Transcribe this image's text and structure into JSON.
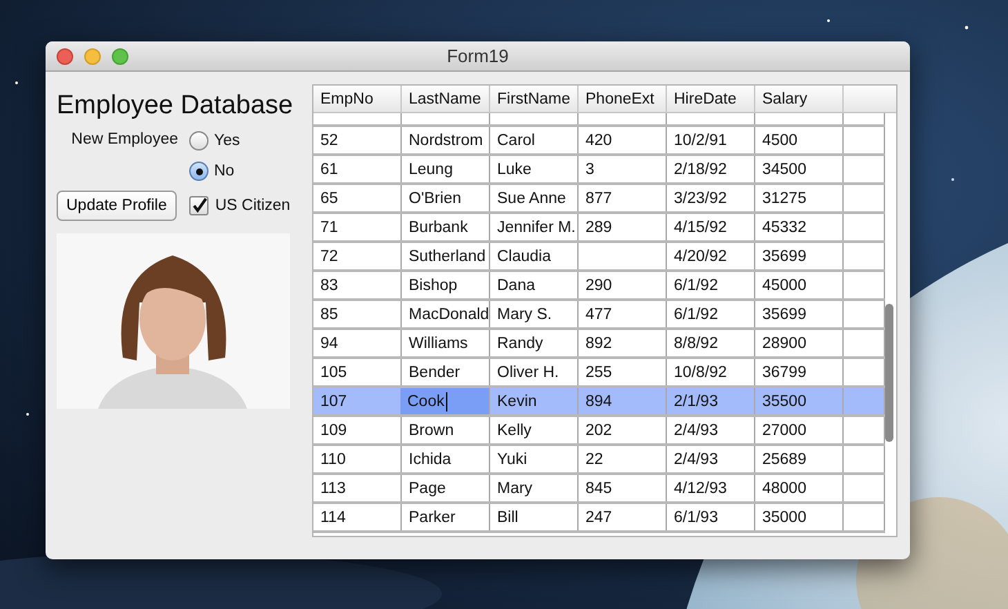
{
  "window": {
    "title": "Form19"
  },
  "form": {
    "heading": "Employee Database",
    "new_employee": {
      "label": "New Employee",
      "options": [
        {
          "label": "Yes",
          "selected": false
        },
        {
          "label": "No",
          "selected": true
        }
      ]
    },
    "update_button": "Update Profile",
    "us_citizen": {
      "label": "US Citizen",
      "checked": true
    }
  },
  "table": {
    "columns": [
      "EmpNo",
      "LastName",
      "FirstName",
      "PhoneExt",
      "HireDate",
      "Salary"
    ],
    "rows": [
      {
        "cells": [
          "52",
          "Nordstrom",
          "Carol",
          "420",
          "10/2/91",
          "4500"
        ],
        "selected": false,
        "editing": false
      },
      {
        "cells": [
          "61",
          "Leung",
          "Luke",
          "3",
          "2/18/92",
          "34500"
        ],
        "selected": false,
        "editing": false
      },
      {
        "cells": [
          "65",
          "O'Brien",
          "Sue Anne",
          "877",
          "3/23/92",
          "31275"
        ],
        "selected": false,
        "editing": false
      },
      {
        "cells": [
          "71",
          "Burbank",
          "Jennifer M.",
          "289",
          "4/15/92",
          "45332"
        ],
        "selected": false,
        "editing": false
      },
      {
        "cells": [
          "72",
          "Sutherland",
          "Claudia",
          null,
          "4/20/92",
          "35699"
        ],
        "selected": false,
        "editing": false
      },
      {
        "cells": [
          "83",
          "Bishop",
          "Dana",
          "290",
          "6/1/92",
          "45000"
        ],
        "selected": false,
        "editing": false
      },
      {
        "cells": [
          "85",
          "MacDonald",
          "Mary S.",
          "477",
          "6/1/92",
          "35699"
        ],
        "selected": false,
        "editing": false
      },
      {
        "cells": [
          "94",
          "Williams",
          "Randy",
          "892",
          "8/8/92",
          "28900"
        ],
        "selected": false,
        "editing": false
      },
      {
        "cells": [
          "105",
          "Bender",
          "Oliver H.",
          "255",
          "10/8/92",
          "36799"
        ],
        "selected": false,
        "editing": false
      },
      {
        "cells": [
          "107",
          "Cook",
          "Kevin",
          "894",
          "2/1/93",
          "35500"
        ],
        "selected": true,
        "editing": true
      },
      {
        "cells": [
          "109",
          "Brown",
          "Kelly",
          "202",
          "2/4/93",
          "27000"
        ],
        "selected": false,
        "editing": false
      },
      {
        "cells": [
          "110",
          "Ichida",
          "Yuki",
          "22",
          "2/4/93",
          "25689"
        ],
        "selected": false,
        "editing": false
      },
      {
        "cells": [
          "113",
          "Page",
          "Mary",
          "845",
          "4/12/93",
          "48000"
        ],
        "selected": false,
        "editing": false
      },
      {
        "cells": [
          "114",
          "Parker",
          "Bill",
          "247",
          "6/1/93",
          "35000"
        ],
        "selected": false,
        "editing": false
      }
    ]
  }
}
